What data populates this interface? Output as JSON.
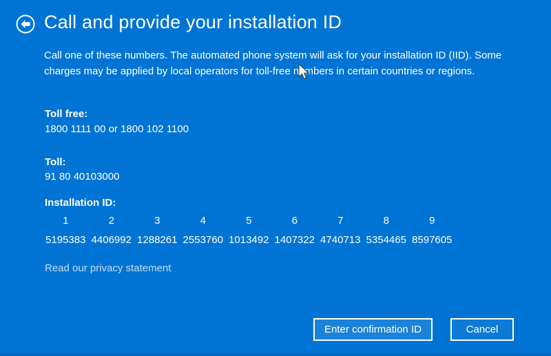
{
  "window": {
    "title": "Call and provide your installation ID"
  },
  "colors": {
    "background": "#0074d4",
    "bottom_edge": "#0065bd",
    "text": "#ffffff",
    "link": "#c6def2"
  },
  "header": {
    "back_icon": "back-arrow-in-circle",
    "title": "Call and provide your installation ID"
  },
  "description": "Call one of these numbers. The automated phone system will ask for your installation ID (IID). Some charges may be applied by local operators for toll-free numbers in certain countries or regions.",
  "toll_free": {
    "label": "Toll free:",
    "value": "1800 1111 00 or 1800 102 1100"
  },
  "toll": {
    "label": "Toll:",
    "value": "91 80 40103000"
  },
  "installation_id": {
    "label": "Installation ID:",
    "columns": [
      "1",
      "2",
      "3",
      "4",
      "5",
      "6",
      "7",
      "8",
      "9"
    ],
    "values": [
      "5195383",
      "4406992",
      "1288261",
      "2553760",
      "1013492",
      "1407322",
      "4740713",
      "5354465",
      "8597605"
    ]
  },
  "privacy_link": "Read our privacy statement",
  "buttons": {
    "confirm": "Enter confirmation ID",
    "cancel": "Cancel"
  }
}
